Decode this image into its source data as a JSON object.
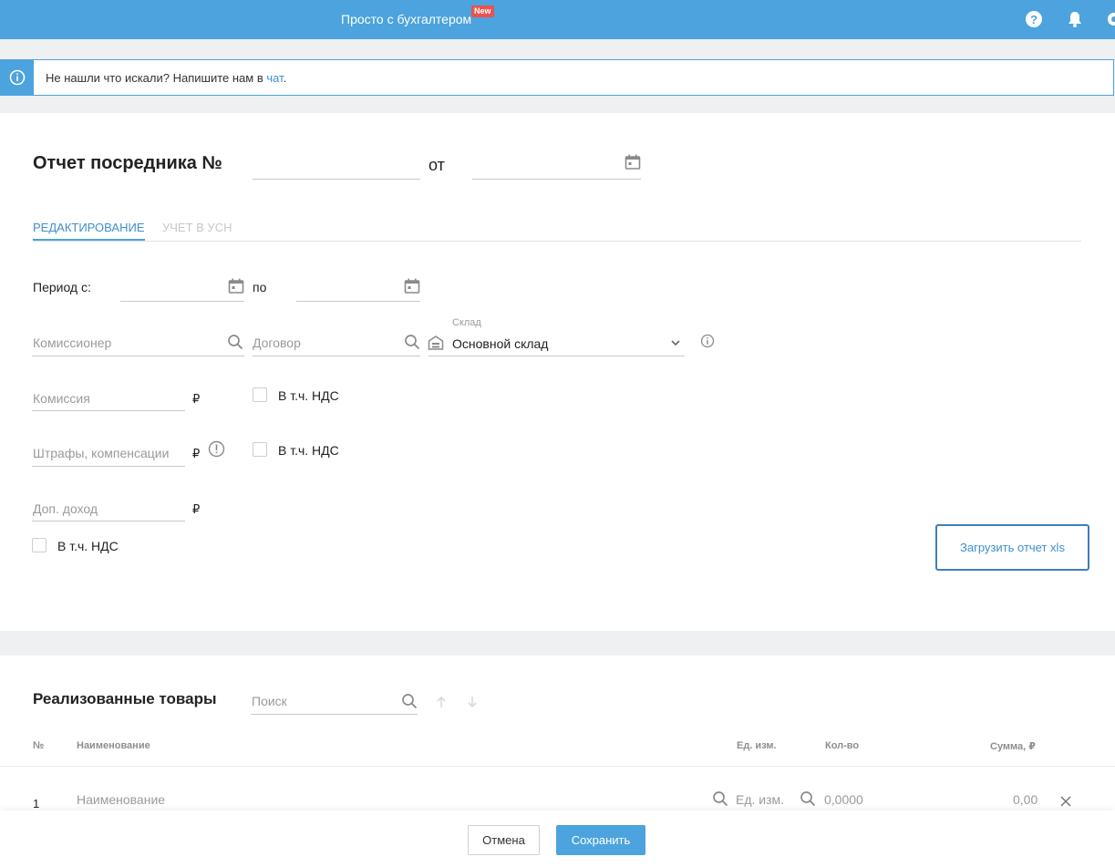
{
  "topbar": {
    "brand": "Просто с бухгалтером",
    "badge": "New",
    "icons": [
      "help-icon",
      "bell-icon",
      "gear-icon"
    ]
  },
  "info": {
    "text": "Не нашли что искали? Напишите нам в ",
    "link": "чат",
    "end": "."
  },
  "report": {
    "title": "Отчет посредника №",
    "number_value": "",
    "date_sep": "от",
    "date_value": ""
  },
  "tabs": [
    {
      "label": "РЕДАКТИРОВАНИЕ",
      "active": true
    },
    {
      "label": "УЧЕТ В УСН",
      "active": false
    }
  ],
  "form": {
    "period_label": "Период с:",
    "period_to": "по",
    "commissioner_ph": "Комиссионер",
    "contract_ph": "Договор",
    "warehouse_label": "Склад",
    "warehouse_value": "Основной склад",
    "commission_ph": "Комиссия",
    "fines_ph": "Штрафы, компенсации",
    "extra_income_ph": "Доп. доход",
    "currency": "₽",
    "vat_label": "В т.ч. НДС",
    "upload_button": "Загрузить отчет xls"
  },
  "goods": {
    "title": "Реализованные товары",
    "search_ph": "Поиск",
    "columns": {
      "num": "№",
      "name": "Наименование",
      "unit": "Ед. изм.",
      "qty": "Кол-во",
      "sum": "Сумма, ₽"
    },
    "rows": [
      {
        "num": "1",
        "name_ph": "Наименование",
        "unit_ph": "Ед. изм.",
        "qty": "0,0000",
        "sum": "0,00"
      }
    ]
  },
  "footer": {
    "cancel": "Отмена",
    "save": "Сохранить"
  },
  "colors": {
    "accent": "#4ca3dd",
    "badge": "#e8534d",
    "link": "#3f8fcd"
  }
}
